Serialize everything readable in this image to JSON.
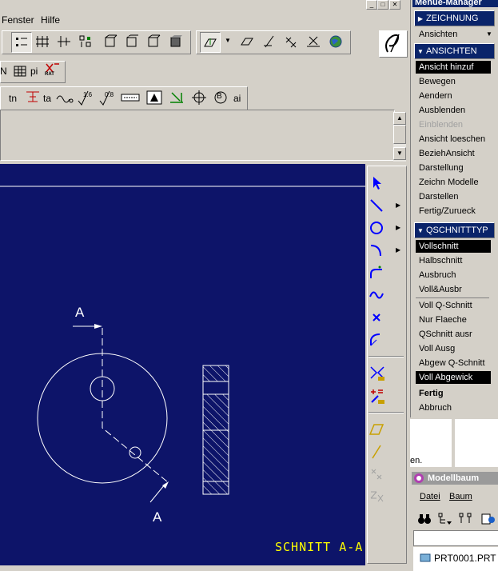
{
  "menubar": {
    "items": [
      "Fenster",
      "Hilfe"
    ]
  },
  "toolbar2": {
    "labels": [
      "N",
      "pi",
      "RAT"
    ]
  },
  "toolbar3": {
    "labels": [
      "tn",
      "ta",
      "1.6",
      "0.8",
      "B",
      "ai"
    ]
  },
  "menu_manager": {
    "title": "Menue-Manager",
    "zeichnung": "ZEICHNUNG",
    "ansichten_dropdown": "Ansichten",
    "ansichten_header": "ANSICHTEN",
    "ansichten_items": [
      {
        "label": "Ansicht hinzuf",
        "state": "selected"
      },
      {
        "label": "Bewegen",
        "state": "normal"
      },
      {
        "label": "Aendern",
        "state": "normal"
      },
      {
        "label": "Ausblenden",
        "state": "normal"
      },
      {
        "label": "Einblenden",
        "state": "disabled"
      },
      {
        "label": "Ansicht loeschen",
        "state": "normal"
      },
      {
        "label": "BeziehAnsicht",
        "state": "normal"
      },
      {
        "label": "Darstellung",
        "state": "normal"
      },
      {
        "label": "Zeichn Modelle",
        "state": "normal"
      },
      {
        "label": "Darstellen",
        "state": "normal"
      },
      {
        "label": "Fertig/Zurueck",
        "state": "normal"
      }
    ],
    "qschnitttyp_header": "QSCHNITTTYP",
    "qschnitt_items": [
      {
        "label": "Vollschnitt",
        "state": "selected"
      },
      {
        "label": "Halbschnitt",
        "state": "normal"
      },
      {
        "label": "Ausbruch",
        "state": "normal"
      },
      {
        "label": "Voll&Ausbr",
        "state": "normal"
      },
      {
        "label": "Voll Q-Schnitt",
        "state": "normal"
      },
      {
        "label": "Nur Flaeche",
        "state": "normal"
      },
      {
        "label": "QSchnitt ausr",
        "state": "normal"
      },
      {
        "label": "Voll Ausg",
        "state": "normal"
      },
      {
        "label": "Abgew Q-Schnitt",
        "state": "normal"
      },
      {
        "label": "Voll Abgewick",
        "state": "selected"
      }
    ],
    "fertig": "Fertig",
    "abbruch": "Abbruch"
  },
  "partial_text": "en.",
  "model_tree": {
    "title": "Modellbaum",
    "menu": [
      "Datei",
      "Baum"
    ],
    "root": "PRT0001.PRT"
  },
  "drawing": {
    "section_label_top": "A",
    "section_label_bottom": "A",
    "section_title": "SCHNITT A-A"
  },
  "colors": {
    "graphics_bg": "#0d1469",
    "geometry": "#ffffff",
    "annotation": "#ffff00",
    "header_bg": "#0a246a"
  }
}
